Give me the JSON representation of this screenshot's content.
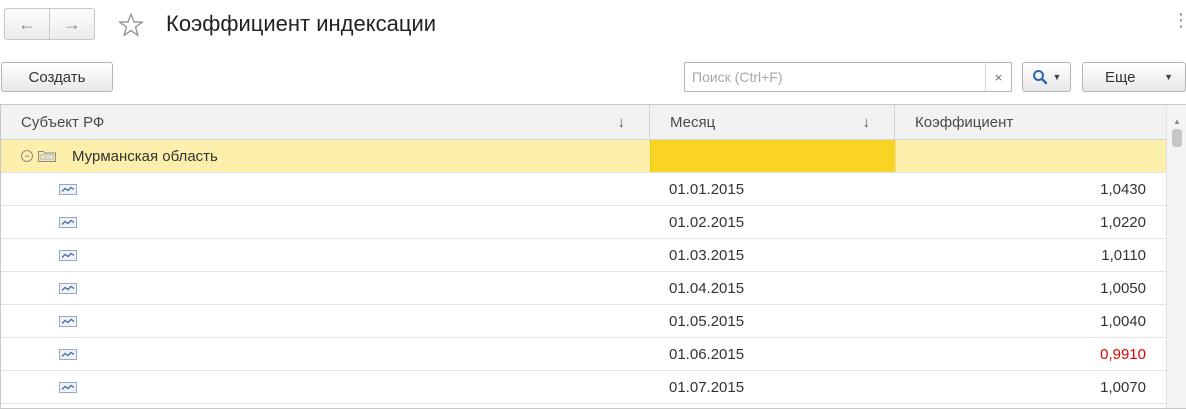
{
  "window": {
    "title": "Коэффициент индексации",
    "nav_back_icon": "arrow-left-icon",
    "nav_forward_icon": "arrow-right-icon",
    "favorite_icon": "star-icon",
    "close_icon": "close-icon"
  },
  "toolbar": {
    "create_label": "Создать",
    "search_placeholder": "Поиск (Ctrl+F)",
    "search_value": "",
    "search_clear_label": "×",
    "more_label": "Еще"
  },
  "grid": {
    "columns": [
      "Субъект РФ",
      "Месяц",
      "Коэффициент"
    ],
    "sorted_columns": [
      "Субъект РФ",
      "Месяц"
    ],
    "group": {
      "name": "Мурманская область",
      "month": "",
      "coefficient": ""
    },
    "rows": [
      {
        "subject": "",
        "month": "01.01.2015",
        "coefficient": "1,0430"
      },
      {
        "subject": "",
        "month": "01.02.2015",
        "coefficient": "1,0220"
      },
      {
        "subject": "",
        "month": "01.03.2015",
        "coefficient": "1,0110"
      },
      {
        "subject": "",
        "month": "01.04.2015",
        "coefficient": "1,0050"
      },
      {
        "subject": "",
        "month": "01.05.2015",
        "coefficient": "1,0040"
      },
      {
        "subject": "",
        "month": "01.06.2015",
        "coefficient": "0,9910"
      },
      {
        "subject": "",
        "month": "01.07.2015",
        "coefficient": "1,0070"
      }
    ]
  },
  "colors": {
    "group_row_bg": "#fbefab",
    "selected_cell_bg": "#fad424",
    "negative_value": "#e00000"
  }
}
